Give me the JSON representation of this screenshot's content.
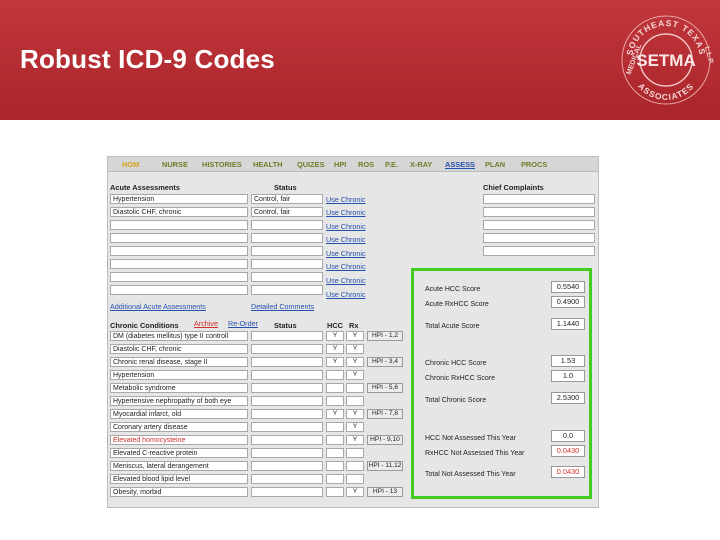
{
  "slide": {
    "title": "Robust ICD-9 Codes"
  },
  "logo": {
    "top_text": "SOUTHEAST TEXAS",
    "left_text": "MEDICAL",
    "right_text": "L.L.P.",
    "bottom_text": "ASSOCIATES",
    "center_text": "SETMA"
  },
  "nav": [
    "HOM",
    "NURSE",
    "HISTORIES",
    "HEALTH",
    "QUIZES",
    "HPI",
    "ROS",
    "P.E.",
    "X-RAY",
    "ASSESS",
    "PLAN",
    "PROCS"
  ],
  "acute": {
    "header": "Acute Assessments",
    "status_header": "Status",
    "rows": [
      {
        "name": "Hypertension",
        "status": "Control, fair",
        "link": "Use Chronic"
      },
      {
        "name": "Diastolic CHF, chronic",
        "status": "Control, fair",
        "link": "Use Chronic"
      },
      {
        "name": "",
        "status": "",
        "link": "Use Chronic"
      },
      {
        "name": "",
        "status": "",
        "link": "Use Chronic"
      },
      {
        "name": "",
        "status": "",
        "link": "Use Chronic"
      },
      {
        "name": "",
        "status": "",
        "link": "Use Chronic"
      },
      {
        "name": "",
        "status": "",
        "link": "Use Chronic"
      },
      {
        "name": "",
        "status": "",
        "link": "Use Chronic"
      }
    ],
    "additional_link": "Additional Acute Assessments",
    "detailed_link": "Detailed Comments"
  },
  "chief": {
    "header": "Chief Complaints"
  },
  "chronic": {
    "header": "Chronic Conditions",
    "archive": "Archive",
    "reorder": "Re-Order",
    "status_header": "Status",
    "hcc_header": "HCC",
    "rx_header": "Rx",
    "rows": [
      {
        "name": "DM (diabetes mellitus) type II controll",
        "hcc": "Y",
        "rx": "Y",
        "hpi": "HPI - 1,2",
        "red": false
      },
      {
        "name": "Diastolic CHF, chronic",
        "hcc": "Y",
        "rx": "Y",
        "hpi": "",
        "red": false
      },
      {
        "name": "Chronic renal disease, stage II",
        "hcc": "Y",
        "rx": "Y",
        "hpi": "HPI - 3,4",
        "red": false
      },
      {
        "name": "Hypertension",
        "hcc": "",
        "rx": "Y",
        "hpi": "",
        "red": false
      },
      {
        "name": "Metabolic syndrome",
        "hcc": "",
        "rx": "",
        "hpi": "HPI - 5,6",
        "red": false
      },
      {
        "name": "Hypertensive nephropathy of both eye",
        "hcc": "",
        "rx": "",
        "hpi": "",
        "red": false
      },
      {
        "name": "Myocardial infarct, old",
        "hcc": "Y",
        "rx": "Y",
        "hpi": "HPI - 7,8",
        "red": false
      },
      {
        "name": "Coronary artery disease",
        "hcc": "",
        "rx": "Y",
        "hpi": "",
        "red": false
      },
      {
        "name": "Elevated homocysteine",
        "hcc": "",
        "rx": "Y",
        "hpi": "HPI - 9,10",
        "red": true
      },
      {
        "name": "Elevated C-reactive protein",
        "hcc": "",
        "rx": "",
        "hpi": "",
        "red": false
      },
      {
        "name": "Meniscus, lateral derangement",
        "hcc": "",
        "rx": "",
        "hpi": "HPI - 11,12",
        "red": false
      },
      {
        "name": "Elevated blood lipid level",
        "hcc": "",
        "rx": "",
        "hpi": "",
        "red": false
      },
      {
        "name": "Obesity, morbid",
        "hcc": "",
        "rx": "Y",
        "hpi": "HPI - 13",
        "red": false
      }
    ]
  },
  "scores": {
    "acute_hcc_label": "Acute HCC Score",
    "acute_hcc": "0.5540",
    "acute_rx_label": "Acute RxHCC Score",
    "acute_rx": "0.4900",
    "total_acute_label": "Total Acute Score",
    "total_acute": "1.1440",
    "chronic_hcc_label": "Chronic HCC Score",
    "chronic_hcc": "1.53",
    "chronic_rx_label": "Chronic RxHCC Score",
    "chronic_rx": "1.0",
    "total_chronic_label": "Total Chronic Score",
    "total_chronic": "2.5300",
    "hcc_na_label": "HCC Not Assessed This Year",
    "hcc_na": "0.0",
    "rx_na_label": "RxHCC Not Assessed This Year",
    "rx_na": "0.0430",
    "total_na_label": "Total Not Assessed This Year",
    "total_na": "0.0430"
  },
  "colors": {
    "header_red": "#b02a2f",
    "highlight_green": "#44cc22",
    "link_blue": "#2450b0",
    "alert_red": "#d0312d"
  }
}
